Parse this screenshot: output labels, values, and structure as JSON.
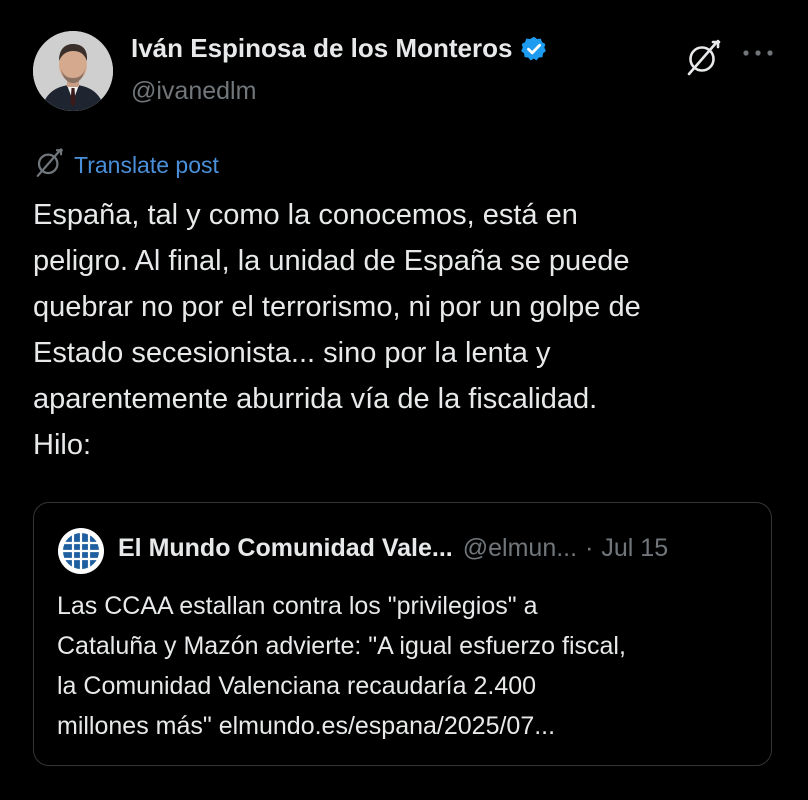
{
  "author": {
    "name": "Iván Espinosa de los Monteros",
    "handle": "@ivanedlm",
    "verified_icon": "verified-badge-icon",
    "verified_color": "#1d9bf0"
  },
  "actions": {
    "grok_icon": "grok-icon",
    "more_icon": "more-icon"
  },
  "translate": {
    "label": "Translate post",
    "icon": "grok-icon",
    "color": "#4a8fd9"
  },
  "post": {
    "lines": [
      "España, tal y como la conocemos, está en",
      "peligro. Al final, la unidad de España se puede",
      "quebrar no por el terrorismo, ni por un golpe de",
      "Estado secesionista... sino por la lenta y",
      "aparentemente aburrida vía de la fiscalidad.",
      "Hilo:"
    ]
  },
  "quote": {
    "name": "El Mundo Comunidad Vale...",
    "handle": "@elmun...",
    "separator": "·",
    "date": "Jul 15",
    "lines": [
      "Las CCAA estallan contra los \"privilegios\" a",
      "Cataluña y Mazón advierte: \"A igual esfuerzo fiscal,",
      "la Comunidad Valenciana recaudaría 2.400",
      "millones más\" elmundo.es/espana/2025/07..."
    ]
  },
  "colors": {
    "background": "#000000",
    "text": "#e7e9ea",
    "muted": "#71767b",
    "border": "#333639"
  }
}
